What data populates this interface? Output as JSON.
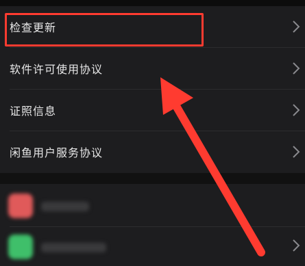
{
  "settings": {
    "items": [
      {
        "label": "检查更新"
      },
      {
        "label": "软件许可使用协议"
      },
      {
        "label": "证照信息"
      },
      {
        "label": "闲鱼用户服务协议"
      }
    ]
  },
  "annotation": {
    "highlight_color": "#ff3b30",
    "arrow_color": "#ff3b30"
  },
  "blurred_section": {
    "icons": [
      {
        "color": "#e05a5a",
        "name": "app-icon-red"
      },
      {
        "color": "#3fbf6a",
        "name": "app-icon-green"
      }
    ]
  }
}
